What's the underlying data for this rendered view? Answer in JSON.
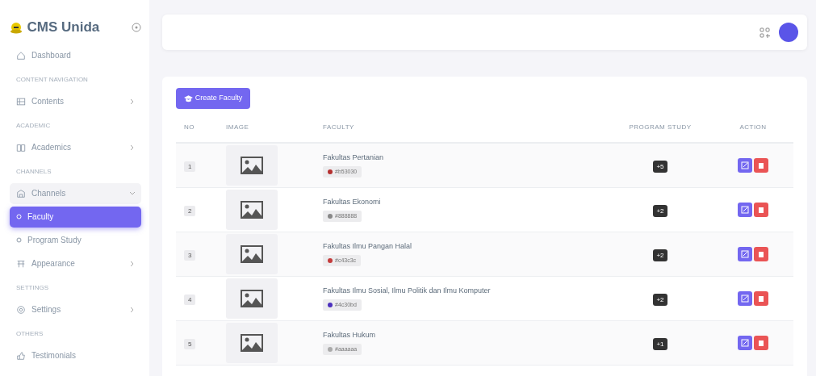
{
  "brand": {
    "title": "CMS Unida"
  },
  "sidebar": {
    "items": [
      {
        "kind": "link",
        "label": "Dashboard",
        "selected": false
      },
      {
        "kind": "header",
        "label": "CONTENT NAVIGATION"
      },
      {
        "kind": "link",
        "label": "Contents",
        "selected": false,
        "expanded": false
      },
      {
        "kind": "header",
        "label": "ACADEMIC"
      },
      {
        "kind": "link",
        "label": "Academics",
        "selected": false,
        "expanded": false
      },
      {
        "kind": "header",
        "label": "CHANNELS"
      },
      {
        "kind": "link",
        "label": "Channels",
        "selected": false,
        "expanded": true,
        "children": [
          {
            "kind": "sub",
            "label": "Faculty",
            "selected": true
          },
          {
            "kind": "sub",
            "label": "Program Study",
            "selected": false
          }
        ]
      },
      {
        "kind": "link",
        "label": "Appearance",
        "selected": false,
        "expanded": false
      },
      {
        "kind": "header",
        "label": "SETTINGS"
      },
      {
        "kind": "link",
        "label": "Settings",
        "selected": false,
        "expanded": false
      },
      {
        "kind": "header",
        "label": "OTHERS"
      },
      {
        "kind": "link",
        "label": "Testimonials",
        "selected": false
      }
    ]
  },
  "create_button": {
    "label": "Create Faculty"
  },
  "table": {
    "columns": [
      "NO",
      "IMAGE",
      "FACULTY",
      "PROGRAM STUDY",
      "ACTION"
    ],
    "rows": [
      {
        "no": "1",
        "faculty": "Fakultas Pertanian",
        "code": "#b53030",
        "color": "#b53030",
        "program_count": "+5"
      },
      {
        "no": "2",
        "faculty": "Fakultas Ekonomi",
        "code": "#888888",
        "color": "#888888",
        "program_count": "+2"
      },
      {
        "no": "3",
        "faculty": "Fakultas Ilmu Pangan Halal",
        "code": "#c43c3c",
        "color": "#c43c3c",
        "program_count": "+2"
      },
      {
        "no": "4",
        "faculty": "Fakultas Ilmu Sosial, Ilmu Politik dan Ilmu Komputer",
        "code": "#4c30bd",
        "color": "#4c30bd",
        "program_count": "+2"
      },
      {
        "no": "5",
        "faculty": "Fakultas Hukum",
        "code": "#aaaaaa",
        "color": "#aaaaaa",
        "program_count": "+1"
      }
    ]
  }
}
